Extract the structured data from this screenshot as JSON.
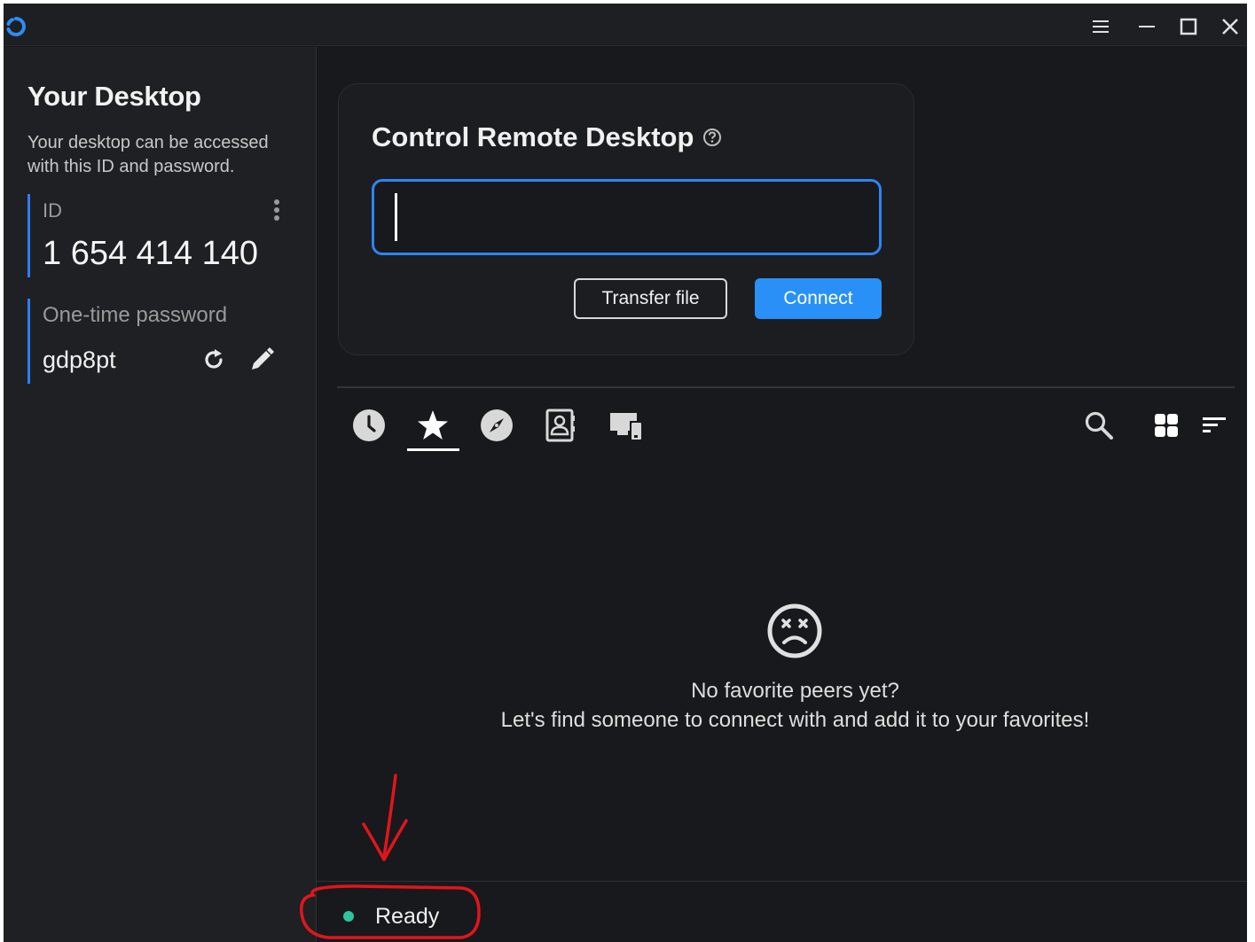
{
  "titlebar": {
    "controls": [
      "menu-icon",
      "minimize-icon",
      "maximize-icon",
      "close-icon"
    ]
  },
  "sidebar": {
    "title": "Your Desktop",
    "description": "Your desktop can be accessed with this ID and password.",
    "id_label": "ID",
    "id_value": "1 654 414 140",
    "password_label": "One-time password",
    "password_value": "gdp8pt"
  },
  "remote": {
    "title": "Control Remote Desktop",
    "input_value": "",
    "transfer_label": "Transfer file",
    "connect_label": "Connect"
  },
  "tabs": [
    {
      "icon": "recent-clock-icon",
      "active": false
    },
    {
      "icon": "favorites-star-icon",
      "active": true
    },
    {
      "icon": "discovered-compass-icon",
      "active": false
    },
    {
      "icon": "address-book-icon",
      "active": false
    },
    {
      "icon": "devices-icon",
      "active": false
    }
  ],
  "empty_state": {
    "line1": "No favorite peers yet?",
    "line2": "Let's find someone to connect with and add it to your favorites!"
  },
  "status": {
    "text": "Ready",
    "color": "#2ec4a0"
  },
  "colors": {
    "accent": "#2990f8",
    "annotation": "#e0161b"
  }
}
